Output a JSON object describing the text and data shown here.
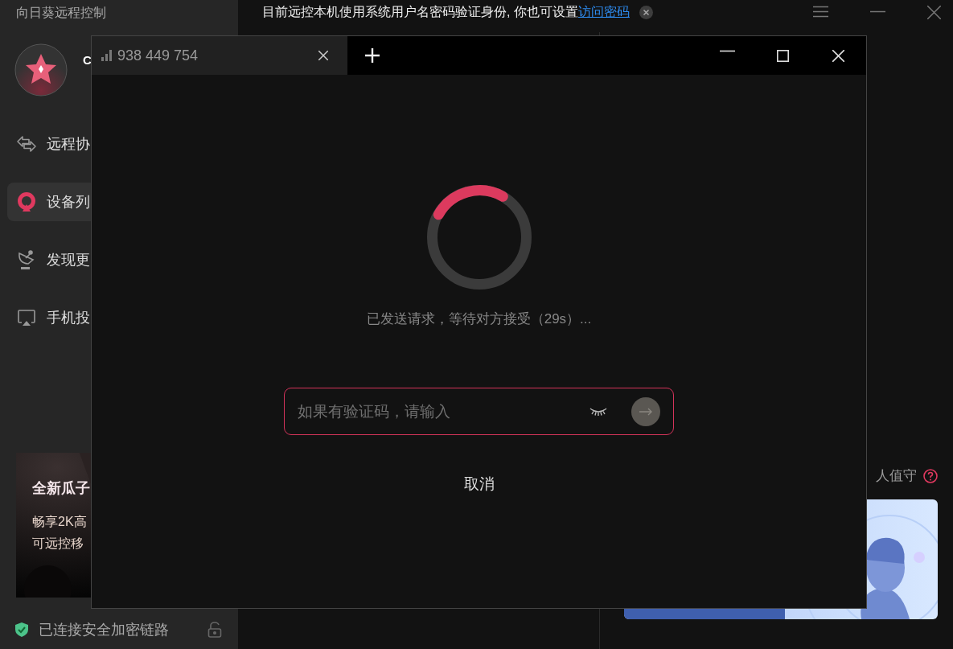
{
  "app": {
    "title": "向日葵远程控制"
  },
  "profile": {
    "name": "C"
  },
  "sidebar": {
    "items": [
      {
        "label": "远程协",
        "selected": false
      },
      {
        "label": "设备列",
        "selected": true
      },
      {
        "label": "发现更",
        "selected": false
      },
      {
        "label": "手机投",
        "selected": false
      }
    ]
  },
  "promo": {
    "title": "全新瓜子",
    "lines": [
      "畅享2K高",
      "可远控移"
    ]
  },
  "status_bar": {
    "text": "已连接安全加密链路"
  },
  "notice": {
    "text": "目前远控本机使用系统用户名密码验证身份, 你也可设置",
    "link": "访问密码"
  },
  "right_panel": {
    "label": "人值守"
  },
  "dialog": {
    "tabs": [
      {
        "label": "938 449 754",
        "selected": true
      }
    ],
    "status": "已发送请求，等待对方接受（29s）...",
    "code_field": {
      "placeholder": "如果有验证码，请输入"
    },
    "cancel": "取消"
  }
}
